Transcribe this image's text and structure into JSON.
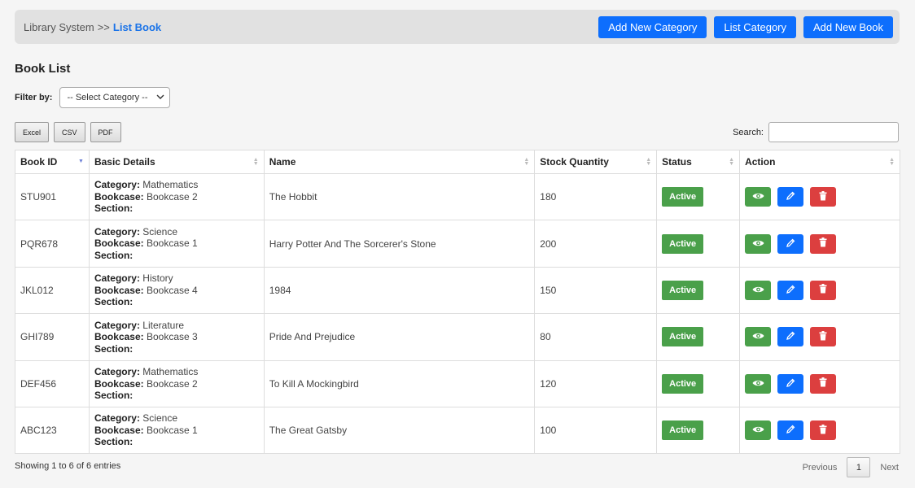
{
  "breadcrumb": {
    "root": "Library System",
    "separator": ">>",
    "current": "List Book"
  },
  "top_buttons": {
    "add_category": "Add New Category",
    "list_category": "List Category",
    "add_book": "Add New Book"
  },
  "heading": "Book List",
  "filter": {
    "label": "Filter by:",
    "selected": "-- Select Category --"
  },
  "exports": {
    "excel": "Excel",
    "csv": "CSV",
    "pdf": "PDF"
  },
  "search": {
    "label": "Search:",
    "value": ""
  },
  "columns": [
    "Book ID",
    "Basic Details",
    "Name",
    "Stock Quantity",
    "Status",
    "Action"
  ],
  "detail_labels": {
    "category": "Category:",
    "bookcase": "Bookcase:",
    "section": "Section:"
  },
  "rows": [
    {
      "id": "STU901",
      "category": "Mathematics",
      "bookcase": "Bookcase 2",
      "section": "",
      "name": "The Hobbit",
      "stock": "180",
      "status": "Active"
    },
    {
      "id": "PQR678",
      "category": "Science",
      "bookcase": "Bookcase 1",
      "section": "",
      "name": "Harry Potter And The Sorcerer's Stone",
      "stock": "200",
      "status": "Active"
    },
    {
      "id": "JKL012",
      "category": "History",
      "bookcase": "Bookcase 4",
      "section": "",
      "name": "1984",
      "stock": "150",
      "status": "Active"
    },
    {
      "id": "GHI789",
      "category": "Literature",
      "bookcase": "Bookcase 3",
      "section": "",
      "name": "Pride And Prejudice",
      "stock": "80",
      "status": "Active"
    },
    {
      "id": "DEF456",
      "category": "Mathematics",
      "bookcase": "Bookcase 2",
      "section": "",
      "name": "To Kill A Mockingbird",
      "stock": "120",
      "status": "Active"
    },
    {
      "id": "ABC123",
      "category": "Science",
      "bookcase": "Bookcase 1",
      "section": "",
      "name": "The Great Gatsby",
      "stock": "100",
      "status": "Active"
    }
  ],
  "action_icons": [
    "eye-icon",
    "pencil-icon",
    "trash-icon"
  ],
  "footer": {
    "info": "Showing 1 to 6 of 6 entries",
    "previous": "Previous",
    "page": "1",
    "next": "Next"
  },
  "colors": {
    "primary": "#0d6efd",
    "success": "#4aa04a",
    "danger": "#dc3f3f",
    "breadcrumb_current": "#1a73e8"
  }
}
